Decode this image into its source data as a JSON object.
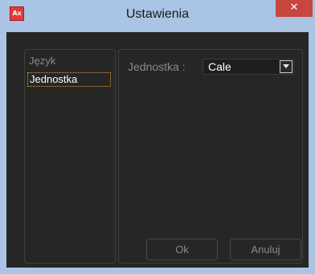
{
  "window": {
    "title": "Ustawienia",
    "app_icon_text": "Ax",
    "close_symbol": "✕"
  },
  "sidebar": {
    "items": [
      {
        "label": "Język",
        "selected": false
      },
      {
        "label": "Jednostka",
        "selected": true
      }
    ]
  },
  "settings": {
    "unit_label": "Jednostka :",
    "unit_value": "Cale"
  },
  "footer": {
    "ok_label": "Ok",
    "cancel_label": "Anuluj"
  },
  "colors": {
    "titlebar": "#a9c4e4",
    "close_button": "#c7463e",
    "client_background": "#262626",
    "selection_border": "#e0a030"
  },
  "icons": {
    "app": "app-icon",
    "close": "close-icon",
    "dropdown": "chevron-down-icon"
  }
}
